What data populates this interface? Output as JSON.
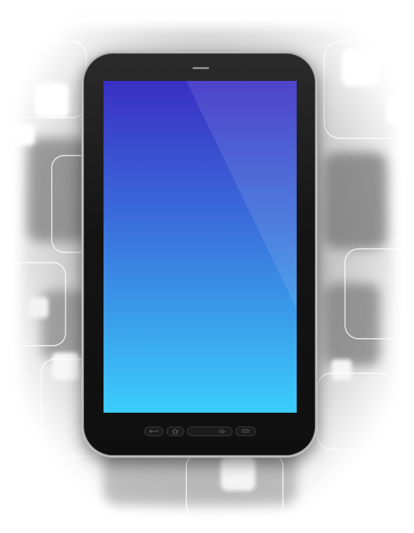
{
  "colors": {
    "screen_top": "#3a2fc4",
    "screen_mid": "#3a72dc",
    "screen_bottom": "#3bcdfb",
    "bezel": "#111111",
    "frame": "#bdbdbd"
  },
  "icons": [
    "back-icon",
    "home-icon",
    "menu-icon",
    "search-icon"
  ]
}
